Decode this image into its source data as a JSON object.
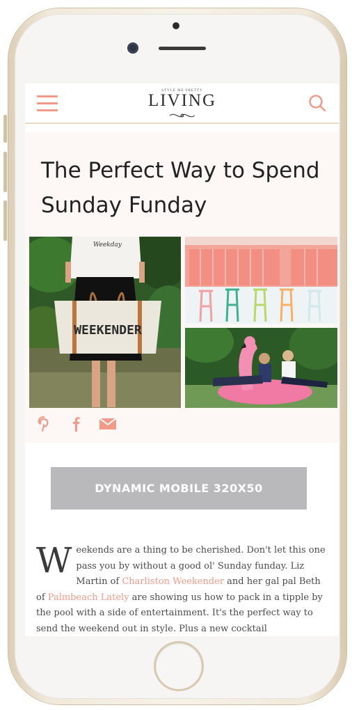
{
  "header": {
    "logo_small": "STYLE ME PRETTY",
    "logo_main": "LIVING",
    "menu_icon": "hamburger-menu-icon",
    "search_icon": "search-icon",
    "accent_color": "#f29a88"
  },
  "article": {
    "title": "The Perfect Way to Spend Sunday Funday",
    "photo_text": "WEEKENDER",
    "tee_text": "Weekday"
  },
  "social": {
    "items": [
      {
        "icon": "pinterest-icon"
      },
      {
        "icon": "facebook-icon"
      },
      {
        "icon": "email-icon"
      }
    ]
  },
  "ad": {
    "label": "DYNAMIC MOBILE 320X50"
  },
  "body": {
    "dropcap": "W",
    "text_1": "eekends are a thing to be cherished. Don't let this one pass you by without a good ol' Sunday funday. Liz Martin of ",
    "link_1": "Charliston Weekender",
    "text_2": " and her gal pal Beth of ",
    "link_2": "Palmbeach Lately",
    "text_3": " are showing us how to pack in a tipple by the pool with a side of entertainment. It's the perfect way to send the weekend out in style. Plus a new cocktail"
  }
}
